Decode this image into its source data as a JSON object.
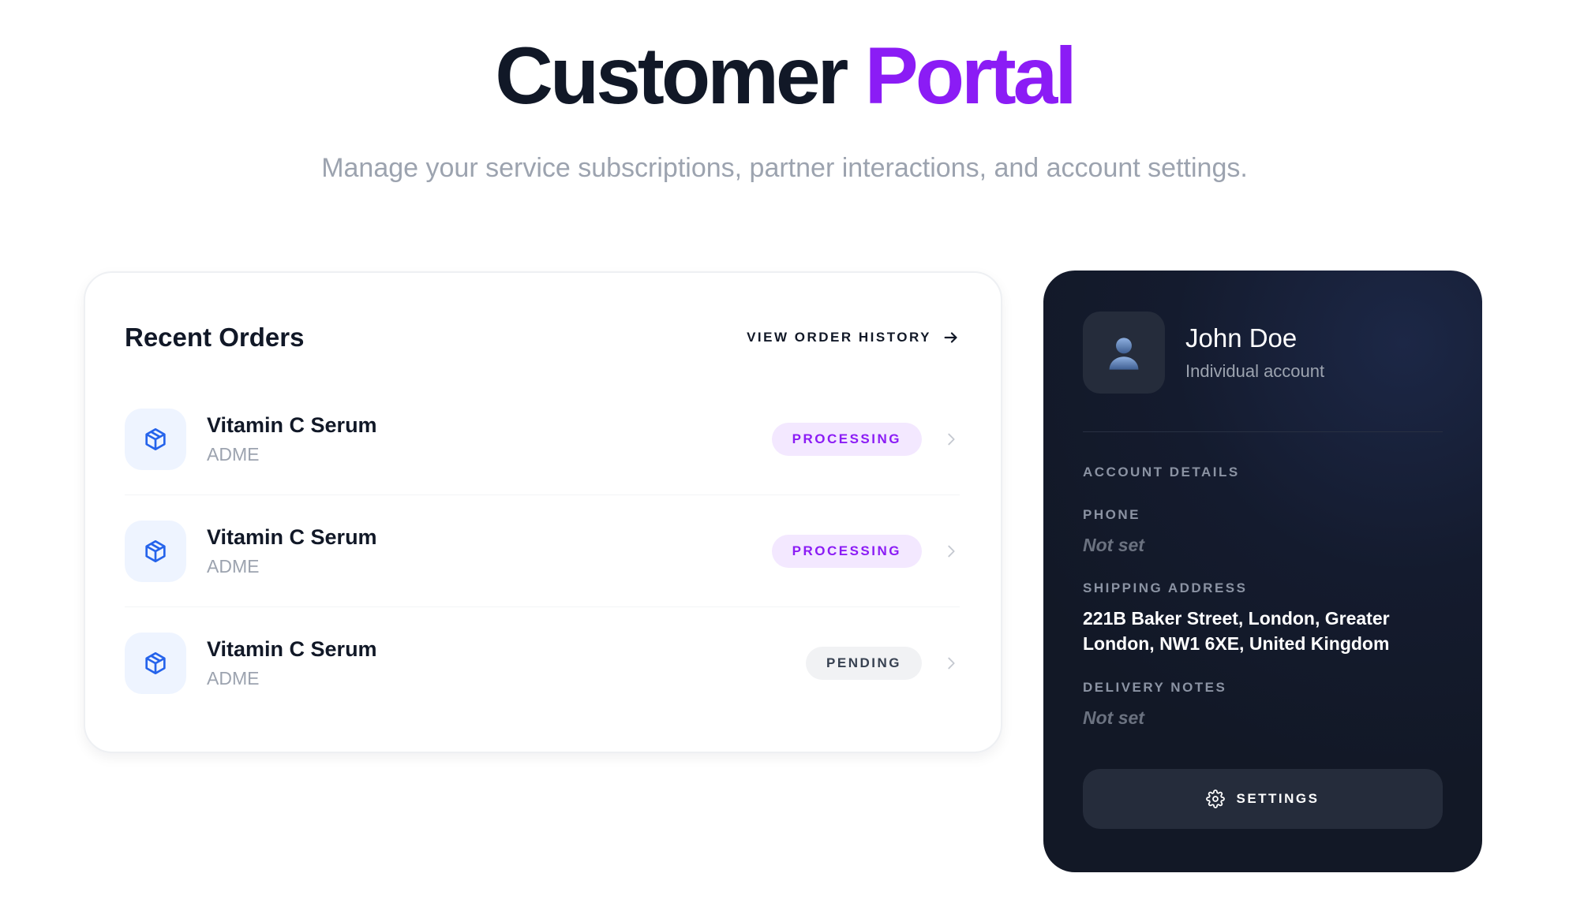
{
  "header": {
    "title_main": "Customer",
    "title_accent": "Portal",
    "subtitle": "Manage your service subscriptions, partner interactions, and account settings."
  },
  "orders": {
    "title": "Recent Orders",
    "history_link": "VIEW ORDER HISTORY",
    "items": [
      {
        "name": "Vitamin C Serum",
        "vendor": "ADME",
        "status": "PROCESSING",
        "status_kind": "processing",
        "icon": "package-icon"
      },
      {
        "name": "Vitamin C Serum",
        "vendor": "ADME",
        "status": "PROCESSING",
        "status_kind": "processing",
        "icon": "package-icon"
      },
      {
        "name": "Vitamin C Serum",
        "vendor": "ADME",
        "status": "PENDING",
        "status_kind": "pending",
        "icon": "package-icon"
      }
    ]
  },
  "profile": {
    "name": "John Doe",
    "account_type": "Individual account",
    "section_label": "ACCOUNT DETAILS",
    "phone_label": "PHONE",
    "phone_value": "Not set",
    "address_label": "SHIPPING ADDRESS",
    "address_value": "221B Baker Street, London, Greater London, NW1 6XE, United Kingdom",
    "notes_label": "DELIVERY NOTES",
    "notes_value": "Not set",
    "settings_label": "SETTINGS"
  },
  "colors": {
    "accent_purple": "#8b1cf5",
    "dark_card": "#121826",
    "icon_blue": "#2563eb"
  }
}
